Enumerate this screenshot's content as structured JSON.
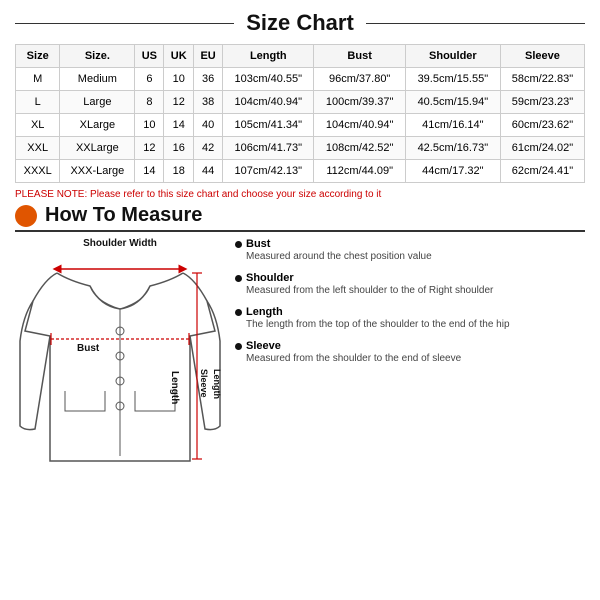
{
  "title": "Size Chart",
  "table": {
    "headers": [
      "Size",
      "Size.",
      "US",
      "UK",
      "EU",
      "Length",
      "Bust",
      "Shoulder",
      "Sleeve"
    ],
    "rows": [
      [
        "M",
        "Medium",
        "6",
        "10",
        "36",
        "103cm/40.55\"",
        "96cm/37.80\"",
        "39.5cm/15.55\"",
        "58cm/22.83\""
      ],
      [
        "L",
        "Large",
        "8",
        "12",
        "38",
        "104cm/40.94\"",
        "100cm/39.37\"",
        "40.5cm/15.94\"",
        "59cm/23.23\""
      ],
      [
        "XL",
        "XLarge",
        "10",
        "14",
        "40",
        "105cm/41.34\"",
        "104cm/40.94\"",
        "41cm/16.14\"",
        "60cm/23.62\""
      ],
      [
        "XXL",
        "XXLarge",
        "12",
        "16",
        "42",
        "106cm/41.73\"",
        "108cm/42.52\"",
        "42.5cm/16.73\"",
        "61cm/24.02\""
      ],
      [
        "XXXL",
        "XXX-Large",
        "14",
        "18",
        "44",
        "107cm/42.13\"",
        "112cm/44.09\"",
        "44cm/17.32\"",
        "62cm/24.41\""
      ]
    ]
  },
  "note": "PLEASE NOTE: Please refer to this size chart and choose your size according to it",
  "how_to_measure": {
    "title": "How To Measure",
    "jacket_labels": {
      "shoulder_width": "Shoulder Width",
      "bust": "Bust",
      "sleeve_length": "Sleeve\nLength",
      "length": "Length"
    },
    "descriptions": [
      {
        "title": "Bust",
        "text": "Measured around the chest position value"
      },
      {
        "title": "Shoulder",
        "text": "Measured from the left shoulder to the of Right shoulder"
      },
      {
        "title": "Length",
        "text": "The length from the top of the shoulder to the end of the hip"
      },
      {
        "title": "Sleeve",
        "text": "Measured from the shoulder to the end of sleeve"
      }
    ]
  }
}
